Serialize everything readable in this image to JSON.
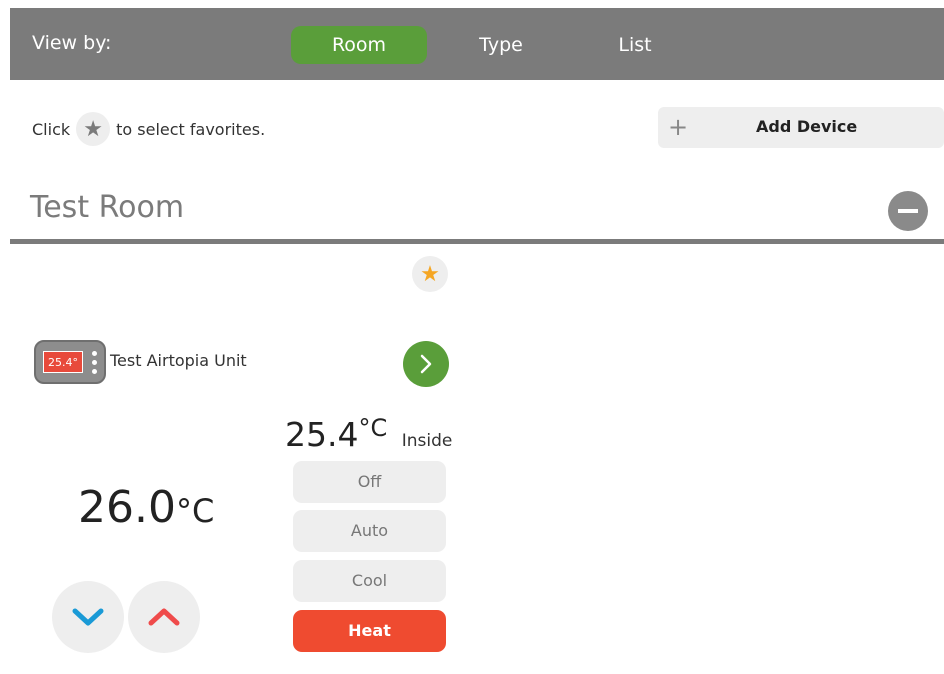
{
  "view_by": {
    "label": "View by:",
    "tabs": [
      {
        "label": "Room",
        "selected": true
      },
      {
        "label": "Type",
        "selected": false
      },
      {
        "label": "List",
        "selected": false
      }
    ]
  },
  "hint": {
    "before": "Click",
    "after": "to select favorites.",
    "icon": "star-icon"
  },
  "add_device": {
    "icon": "plus-icon",
    "label": "Add Device"
  },
  "room": {
    "title": "Test Room",
    "collapse_icon": "minus-icon"
  },
  "device": {
    "favorite": true,
    "favorite_color": "#f5a623",
    "icon_display": "25.4°",
    "name": "Test Airtopia Unit",
    "inside_temp": "25.4",
    "inside_unit": "°C",
    "inside_label": "Inside",
    "setpoint": "26.0",
    "setpoint_unit": "°C",
    "modes": [
      {
        "label": "Off",
        "active": false
      },
      {
        "label": "Auto",
        "active": false
      },
      {
        "label": "Cool",
        "active": false
      },
      {
        "label": "Heat",
        "active": true
      }
    ],
    "down_color": "#1a9ad6",
    "up_color": "#ef4b4b"
  },
  "colors": {
    "header_bg": "#7b7b7b",
    "accent_green": "#5a9e3a",
    "heat_active": "#ef4b30"
  }
}
